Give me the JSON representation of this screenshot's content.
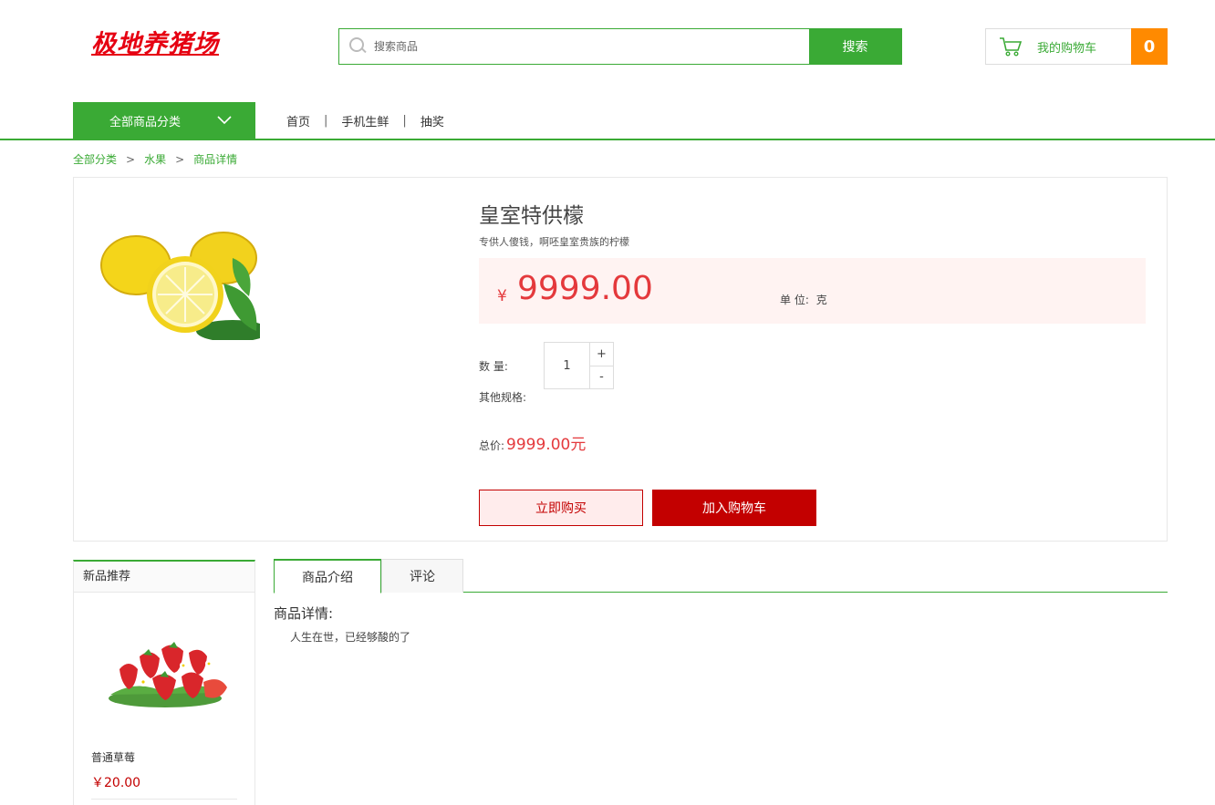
{
  "header": {
    "logo_text": "极地养猪场",
    "search": {
      "placeholder": "搜索商品",
      "button_label": "搜索"
    },
    "cart": {
      "label": "我的购物车",
      "count": "0"
    }
  },
  "nav": {
    "all_categories": "全部商品分类",
    "links": [
      "首页",
      "手机生鲜",
      "抽奖"
    ],
    "separator": "|"
  },
  "breadcrumb": {
    "items": [
      "全部分类",
      "水果",
      "商品详情"
    ],
    "separator": ">"
  },
  "product": {
    "title": "皇室特供檬",
    "subtitle": "专供人傻钱，啊呸皇室贵族的柠檬",
    "currency_symbol": "¥",
    "price": "9999.00",
    "unit_label": "单 位:",
    "unit_value": "克",
    "quantity_label": "数 量:",
    "quantity": "1",
    "plus": "+",
    "minus": "-",
    "spec_label": "其他规格:",
    "total_label": "总价:",
    "total_value": "9999.00元",
    "buy_now": "立即购买",
    "add_to_cart": "加入购物车"
  },
  "sidebar": {
    "title": "新品推荐",
    "item": {
      "name": "普通草莓",
      "price": "￥20.00"
    }
  },
  "tabs": {
    "items": [
      "商品介绍",
      "评论"
    ],
    "active": "商品介绍"
  },
  "detail": {
    "title": "商品详情:",
    "text": "人生在世，已经够酸的了"
  },
  "colors": {
    "brand_green": "#3aaa35",
    "price_red": "#e4393c",
    "button_red": "#c30000",
    "cart_orange": "#ff8a00",
    "logo_red": "#e60012"
  }
}
